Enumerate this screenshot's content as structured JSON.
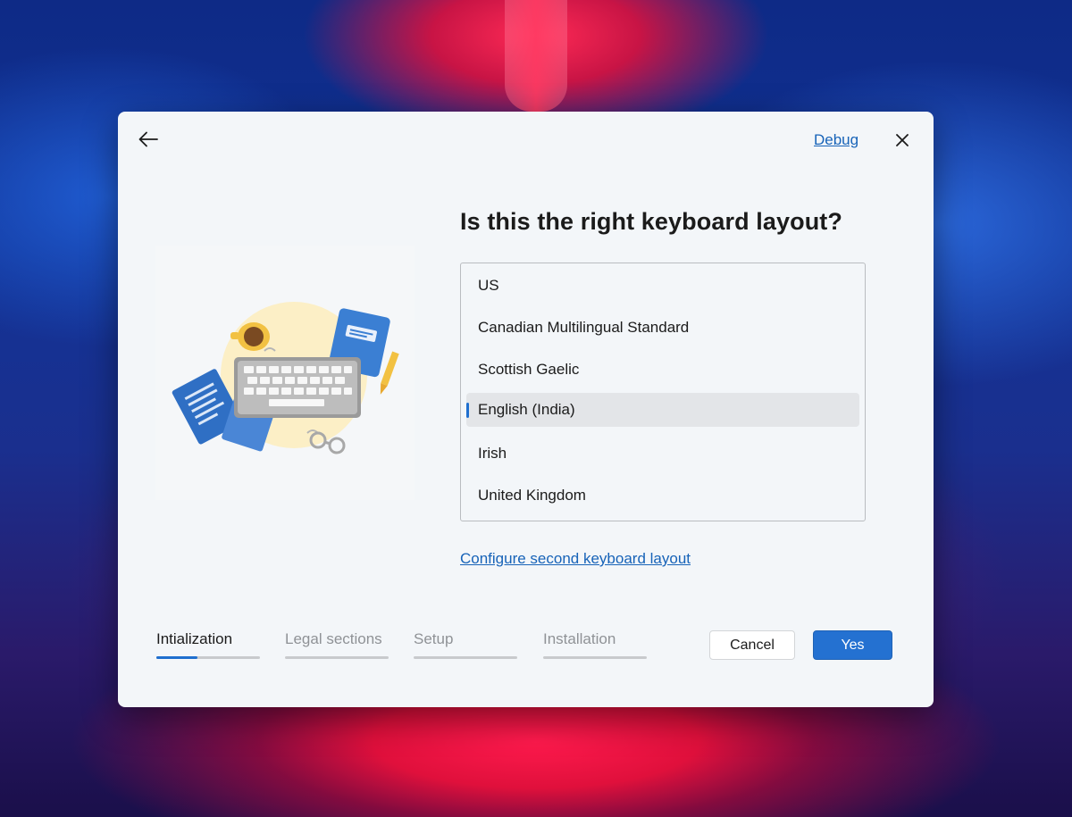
{
  "header": {
    "back_icon": "arrow-left-icon",
    "debug_label": "Debug",
    "close_icon": "close-icon"
  },
  "illustration": {
    "description_icon": "keyboard-desk-illustration"
  },
  "main": {
    "title": "Is this the right keyboard layout?",
    "layouts": [
      {
        "label": "US"
      },
      {
        "label": "Canadian Multilingual Standard"
      },
      {
        "label": "Scottish Gaelic"
      },
      {
        "label": "English (India)",
        "selected": true
      },
      {
        "label": "Irish"
      },
      {
        "label": "United Kingdom"
      }
    ],
    "configure_link": "Configure second keyboard layout"
  },
  "footer": {
    "steps": [
      {
        "label": "Intialization",
        "active": true,
        "progress": 0.4
      },
      {
        "label": "Legal sections",
        "active": false,
        "progress": 0
      },
      {
        "label": "Setup",
        "active": false,
        "progress": 0
      },
      {
        "label": "Installation",
        "active": false,
        "progress": 0
      }
    ],
    "cancel_label": "Cancel",
    "yes_label": "Yes"
  },
  "colors": {
    "accent": "#2471d1",
    "link": "#1763b8",
    "dialog_bg": "#f3f6f9",
    "selected_bg": "#e3e5e8"
  }
}
